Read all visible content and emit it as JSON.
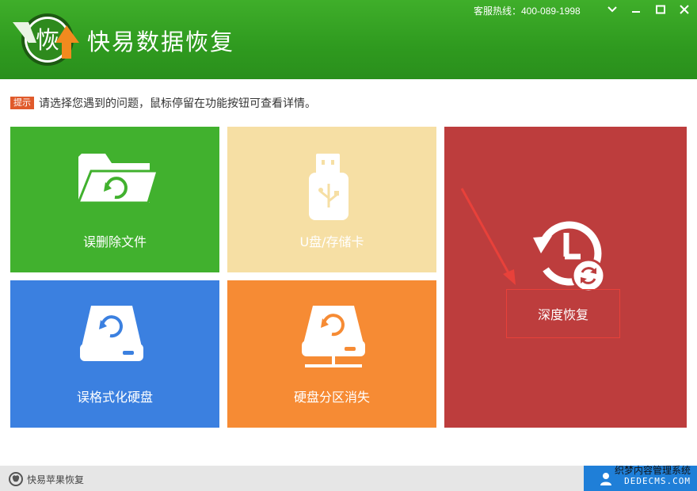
{
  "header": {
    "logo_char": "恢",
    "title": "快易数据恢复",
    "hotline": "客服热线：400-089-1998"
  },
  "window_controls": {
    "icons": [
      "chevron-down-icon",
      "minimize-icon",
      "maximize-icon",
      "close-icon"
    ]
  },
  "hint": {
    "badge": "提示",
    "text": "请选择您遇到的问题，鼠标停留在功能按钮可查看详情。"
  },
  "tiles": [
    {
      "label": "误删除文件",
      "color": "#41b12e",
      "icon": "folder-refresh-icon"
    },
    {
      "label": "U盘/存储卡",
      "color": "#f6dfa4",
      "icon": "usb-drive-icon"
    },
    {
      "label": "深度恢复",
      "color": "#bd3d3d",
      "icon": "history-refresh-icon"
    },
    {
      "label": "误格式化硬盘",
      "color": "#3b80e0",
      "icon": "hard-disk-icon"
    },
    {
      "label": "硬盘分区消失",
      "color": "#f68b34",
      "icon": "network-disk-icon"
    }
  ],
  "footer": {
    "apple_label": "快易苹果恢复",
    "watermark_line1": "织梦内容管理系统",
    "watermark_line2": "DEDECMS.COM"
  }
}
